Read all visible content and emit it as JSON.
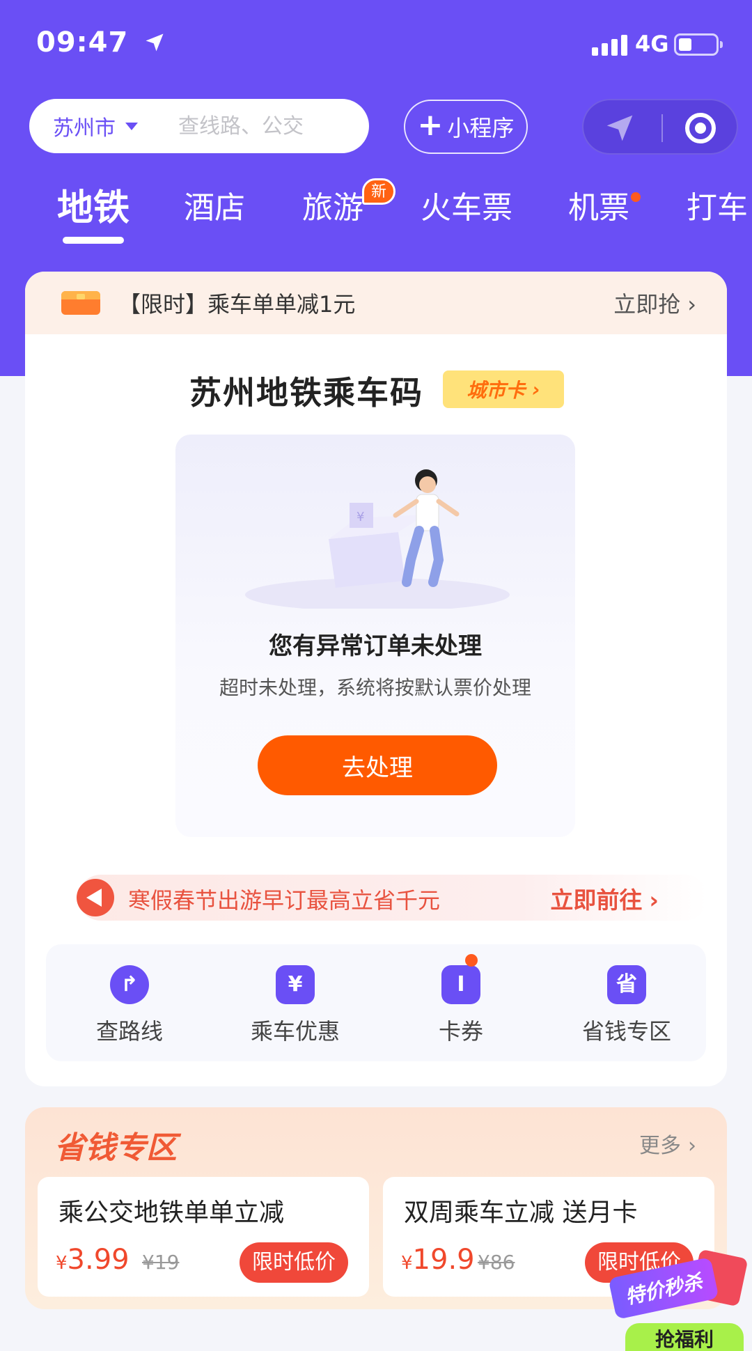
{
  "status": {
    "time": "09:47",
    "network": "4G"
  },
  "header": {
    "city": "苏州市",
    "search_placeholder": "查线路、公交",
    "mini_program_label": "小程序"
  },
  "tabs": [
    {
      "label": "地铁",
      "active": true
    },
    {
      "label": "酒店"
    },
    {
      "label": "旅游",
      "badge": "新"
    },
    {
      "label": "火车票"
    },
    {
      "label": "机票",
      "dot": true
    },
    {
      "label": "打车"
    }
  ],
  "promo": {
    "text": "【限时】乘车单单减1元",
    "cta": "立即抢"
  },
  "main": {
    "title": "苏州地铁乘车码",
    "city_card_label": "城市卡"
  },
  "order": {
    "title": "您有异常订单未处理",
    "description": "超时未处理，系统将按默认票价处理",
    "button": "去处理"
  },
  "notice": {
    "text": "寒假春节出游早订最高立省千元",
    "cta": "立即前往"
  },
  "quick_actions": [
    {
      "label": "查路线",
      "icon": "route-icon"
    },
    {
      "label": "乘车优惠",
      "icon": "yen-wallet-icon"
    },
    {
      "label": "卡券",
      "icon": "ticket-icon",
      "dot": true
    },
    {
      "label": "省钱专区",
      "icon": "save-icon",
      "glyph": "省"
    }
  ],
  "savings": {
    "title": "省钱专区",
    "more": "更多",
    "deals": [
      {
        "title": "乘公交地铁单单立减",
        "currency": "¥",
        "price": "3.99",
        "old_price": "¥19",
        "tag": "限时低价"
      },
      {
        "title": "双周乘车立减 送月卡",
        "currency": "¥",
        "price": "19.9",
        "old_price": "¥86",
        "tag": "限时低价"
      }
    ]
  },
  "floating": {
    "label": "特价秒杀",
    "grab": "抢福利"
  },
  "colors": {
    "brand": "#6a4ff5",
    "accent": "#ff5a00",
    "price": "#f0482c"
  }
}
